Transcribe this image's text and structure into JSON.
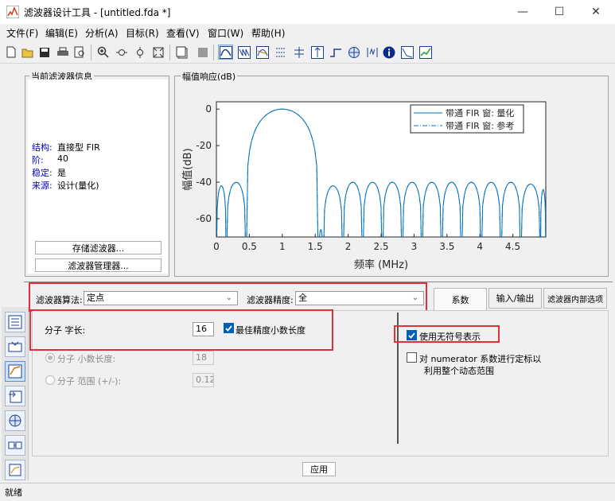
{
  "window": {
    "title": "滤波器设计工具 - [untitled.fda *]",
    "controls": {
      "minimize": "—",
      "maximize": "☐",
      "close": "✕"
    }
  },
  "menu": [
    "文件(F)",
    "编辑(E)",
    "分析(A)",
    "目标(R)",
    "查看(V)",
    "窗口(W)",
    "帮助(H)"
  ],
  "toolbar_icons": [
    "new-file-icon",
    "open-folder-icon",
    "save-icon",
    "print-icon",
    "print-preview-icon",
    "zoom-in-icon",
    "zoom-x-icon",
    "zoom-y-icon",
    "full-view-icon",
    "new-window-icon",
    "stop-icon",
    "magnitude-response-icon",
    "phase-response-icon",
    "magnitude-phase-icon",
    "group-delay-icon",
    "phase-delay-icon",
    "impulse-response-icon",
    "step-response-icon",
    "pole-zero-icon",
    "filter-coefficients-icon",
    "info-icon",
    "magnitude-estimate-icon",
    "noise-power-icon"
  ],
  "current_filter": {
    "heading": "当前滤波器信息",
    "rows": [
      {
        "label": "结构:",
        "value": "直接型 FIR"
      },
      {
        "label": "阶:",
        "value": "40"
      },
      {
        "label": "稳定:",
        "value": "是"
      },
      {
        "label": "来源:",
        "value": "设计(量化)"
      }
    ],
    "store_button": "存储滤波器...",
    "manager_button": "滤波器管理器..."
  },
  "magnitude_panel": {
    "heading": "幅值响应(dB)"
  },
  "chart_data": {
    "type": "line",
    "xlabel": "频率 (MHz)",
    "ylabel": "幅值(dB)",
    "xlim": [
      0,
      5
    ],
    "ylim": [
      -70,
      4
    ],
    "xticks": [
      "0",
      "0.5",
      "1",
      "1.5",
      "2",
      "2.5",
      "3",
      "3.5",
      "4",
      "4.5"
    ],
    "yticks": [
      "0",
      "-20",
      "-40",
      "-60"
    ],
    "legend_position": "top-right",
    "series": [
      {
        "name": "带通 FIR 窗: 量化",
        "style": "solid",
        "color": "#0072bd"
      },
      {
        "name": "带通 FIR 窗: 参考",
        "style": "dashdot",
        "color": "#0072bd"
      }
    ],
    "mainlobe": {
      "center": 1.0,
      "edges": [
        0.45,
        1.55
      ],
      "peak": 0
    },
    "sidelobes_left": [
      {
        "from": 0.0,
        "to": 0.15,
        "peak": -42
      },
      {
        "from": 0.15,
        "to": 0.45,
        "peak": -40
      }
    ],
    "sidelobes_right": [
      {
        "from": 1.55,
        "to": 1.62,
        "peak": -66
      },
      {
        "from": 1.62,
        "to": 1.92,
        "peak": -42
      },
      {
        "from": 1.92,
        "to": 2.22,
        "peak": -40
      },
      {
        "from": 2.22,
        "to": 2.52,
        "peak": -40
      },
      {
        "from": 2.52,
        "to": 2.82,
        "peak": -40
      },
      {
        "from": 2.82,
        "to": 3.12,
        "peak": -40
      },
      {
        "from": 3.12,
        "to": 3.42,
        "peak": -40
      },
      {
        "from": 3.42,
        "to": 3.72,
        "peak": -40
      },
      {
        "from": 3.72,
        "to": 4.02,
        "peak": -40
      },
      {
        "from": 4.02,
        "to": 4.32,
        "peak": -40
      },
      {
        "from": 4.32,
        "to": 4.62,
        "peak": -40
      },
      {
        "from": 4.62,
        "to": 4.92,
        "peak": -41
      },
      {
        "from": 4.92,
        "to": 5.0,
        "peak": -44
      }
    ]
  },
  "quantization": {
    "algorithm_label": "滤波器算法:",
    "algorithm_value": "定点",
    "precision_label": "滤波器精度:",
    "precision_value": "全",
    "tabs": [
      "系数",
      "输入/输出",
      "滤波器内部选项"
    ],
    "numerator_wordlength_label": "分子 字长:",
    "numerator_wordlength_value": "16",
    "best_precision_label": "最佳精度小数长度",
    "numerator_fraclength_label": "分子 小数长度:",
    "numerator_fraclength_value": "18",
    "numerator_range_label": "分子 范围 (+/-):",
    "numerator_range_value": "0.125",
    "unsigned_label": "使用无符号表示",
    "normalize_label_1": "对 numerator 系数进行定标以",
    "normalize_label_2": "利用整个动态范围",
    "apply_button": "应用"
  },
  "sidebar_icons": [
    "set-quantization-icon",
    "transform-filter-icon",
    "design-filter-icon",
    "import-filter-icon",
    "pole-zero-editor-icon",
    "realize-model-icon",
    "multirate-icon"
  ],
  "status": {
    "text": "就绪"
  }
}
